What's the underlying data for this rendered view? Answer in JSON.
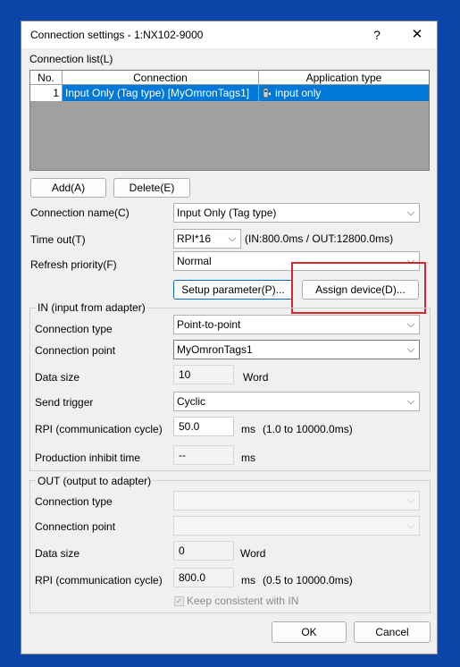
{
  "window": {
    "title": "Connection settings  - 1:NX102-9000",
    "help_label": "?",
    "close_label": "✕"
  },
  "connection_list": {
    "label": "Connection list(L)",
    "columns": [
      "No.",
      "Connection",
      "Application type"
    ],
    "rows": [
      {
        "no": "1",
        "connection": "Input Only (Tag type) [MyOmronTags1]",
        "application_type": "input only"
      }
    ],
    "add_label": "Add(A)",
    "delete_label": "Delete(E)"
  },
  "form": {
    "connection_name_label": "Connection name(C)",
    "connection_name_value": "Input Only (Tag type)",
    "timeout_label": "Time out(T)",
    "timeout_value": "RPI*16",
    "timeout_info": "(IN:800.0ms / OUT:12800.0ms)",
    "refresh_label": "Refresh priority(F)",
    "refresh_value": "Normal",
    "setup_label": "Setup parameter(P)...",
    "assign_label": "Assign device(D)..."
  },
  "in_group": {
    "legend": "IN (input from adapter)",
    "connection_type_label": "Connection type",
    "connection_type_value": "Point-to-point",
    "connection_point_label": "Connection point",
    "connection_point_value": "MyOmronTags1",
    "data_size_label": "Data size",
    "data_size_value": "10",
    "data_size_unit": "Word",
    "send_trigger_label": "Send trigger",
    "send_trigger_value": "Cyclic",
    "rpi_label": "RPI (communication cycle)",
    "rpi_value": "50.0",
    "rpi_unit": "ms",
    "rpi_range": "(1.0 to 10000.0ms)",
    "inhibit_label": "Production inhibit time",
    "inhibit_value": "--",
    "inhibit_unit": "ms"
  },
  "out_group": {
    "legend": "OUT (output to adapter)",
    "connection_type_label": "Connection type",
    "connection_type_value": "",
    "connection_point_label": "Connection point",
    "connection_point_value": "",
    "data_size_label": "Data size",
    "data_size_value": "0",
    "data_size_unit": "Word",
    "rpi_label": "RPI (communication cycle)",
    "rpi_value": "800.0",
    "rpi_unit": "ms",
    "rpi_range": "(0.5 to 10000.0ms)",
    "keep_consistent_label": "Keep consistent with IN",
    "keep_consistent_checked": true
  },
  "footer": {
    "ok_label": "OK",
    "cancel_label": "Cancel"
  },
  "colors": {
    "selection": "#0078d7",
    "highlight_box": "#d9262d",
    "desktop": "#0d44a8"
  }
}
